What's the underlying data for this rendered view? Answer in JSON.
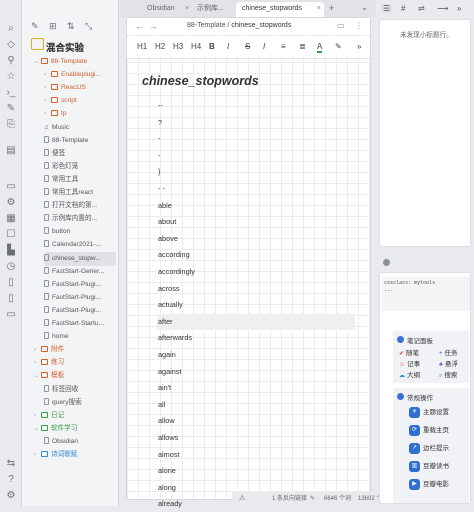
{
  "ribbon": {
    "icons": [
      "file-explorer-icon",
      "search-icon",
      "tag-icon",
      "graph-icon",
      "star-icon",
      "settings-icon",
      "tag-pane-icon",
      "terminal-icon",
      "calendar-icon",
      "template-icon",
      "outline-icon",
      "page-icon",
      "help-icon",
      "vault-settings-icon"
    ]
  },
  "explorer": {
    "vault_name": "混合实验",
    "tree": [
      {
        "label": "88-Template",
        "type": "folder",
        "level": 0,
        "open": true,
        "color": "#d4602b"
      },
      {
        "label": "Enableplugi...",
        "type": "folder",
        "level": 1,
        "open": false,
        "color": "#d4602b"
      },
      {
        "label": "ReactJS",
        "type": "folder",
        "level": 1,
        "open": false,
        "color": "#d4602b"
      },
      {
        "label": "script",
        "type": "folder",
        "level": 1,
        "open": false,
        "color": "#d4602b"
      },
      {
        "label": "tp",
        "type": "folder",
        "level": 1,
        "open": false,
        "color": "#d4602b"
      },
      {
        "label": "Music",
        "type": "file-music",
        "level": 1
      },
      {
        "label": "88-Template",
        "type": "file",
        "level": 1
      },
      {
        "label": "便签",
        "type": "file",
        "level": 1
      },
      {
        "label": "彩色灯笼",
        "type": "file",
        "level": 1
      },
      {
        "label": "常用工具",
        "type": "file",
        "level": 1
      },
      {
        "label": "常用工具react",
        "type": "file",
        "level": 1
      },
      {
        "label": "打开文档的第...",
        "type": "file",
        "level": 1
      },
      {
        "label": "示例库内置的...",
        "type": "file",
        "level": 1
      },
      {
        "label": "button",
        "type": "file",
        "level": 1
      },
      {
        "label": "Calendar2021-...",
        "type": "file",
        "level": 1
      },
      {
        "label": "chinese_stopw...",
        "type": "file",
        "level": 1,
        "selected": true
      },
      {
        "label": "FastStart-Gener...",
        "type": "file",
        "level": 1
      },
      {
        "label": "FastStart-Plugi...",
        "type": "file",
        "level": 1
      },
      {
        "label": "FastStart-Plugi...",
        "type": "file",
        "level": 1
      },
      {
        "label": "FastStart-Plugi...",
        "type": "file",
        "level": 1
      },
      {
        "label": "FastStart-Startu...",
        "type": "file",
        "level": 1
      },
      {
        "label": "home",
        "type": "file",
        "level": 1
      },
      {
        "label": "附件",
        "type": "folder",
        "level": 0,
        "open": false,
        "color": "#d4602b"
      },
      {
        "label": "练习",
        "type": "folder",
        "level": 0,
        "open": false,
        "color": "#d4602b"
      },
      {
        "label": "模板",
        "type": "folder",
        "level": 0,
        "open": true,
        "color": "#d4602b"
      },
      {
        "label": "标签回收",
        "type": "file",
        "level": 1
      },
      {
        "label": "query搜索",
        "type": "file",
        "level": 1
      },
      {
        "label": "日记",
        "type": "folder",
        "level": 0,
        "open": false,
        "color": "#3d9a4b"
      },
      {
        "label": "软件学习",
        "type": "folder",
        "level": 0,
        "open": true,
        "color": "#3d9a4b"
      },
      {
        "label": "Obsidian",
        "type": "file",
        "level": 1
      },
      {
        "label": "诗词歌赋",
        "type": "folder",
        "level": 0,
        "open": false,
        "color": "#2f8ad2"
      }
    ]
  },
  "tabs": [
    {
      "label": "Obsidian",
      "active": false
    },
    {
      "label": "示例库...",
      "active": false
    },
    {
      "label": "chinese_stopwords",
      "active": true
    }
  ],
  "editor": {
    "breadcrumb_folder": "88-Template",
    "breadcrumb_sep": "/",
    "breadcrumb_file": "chinese_stopwords",
    "toolbar": [
      "H1",
      "H2",
      "H3",
      "H4",
      "B",
      "I",
      "S",
      "I",
      "≡",
      "≣",
      "A",
      "✎"
    ],
    "title": "chinese_stopwords",
    "words": [
      "--",
      "?",
      "-",
      "-",
      "}",
      "- -",
      "able",
      "about",
      "above",
      "according",
      "accordingly",
      "across",
      "actually",
      "after",
      "afterwards",
      "again",
      "against",
      "ain't",
      "all",
      "allow",
      "allows",
      "almost",
      "alone",
      "along",
      "already"
    ],
    "highlighted_word": "after"
  },
  "status": {
    "backlinks": "1 条反向链接",
    "words": "6646 个词",
    "chars": "13602 个字符"
  },
  "right_sidebar": {
    "outline_empty": "未发现小标题行。",
    "code_lines": [
      "cssclass: mytools",
      "---"
    ],
    "panel1_title": "笔记面板",
    "panel1_items": [
      {
        "icon": "✔",
        "label": "随笔"
      },
      {
        "icon": "+",
        "label": "任务"
      },
      {
        "icon": "☺",
        "label": "记事"
      },
      {
        "icon": "♣",
        "label": "悬浮"
      },
      {
        "icon": "☁",
        "label": "大纲"
      },
      {
        "icon": "⌕",
        "label": "搜索"
      }
    ],
    "panel2_title": "常规操作",
    "actions": [
      "主题设置",
      "重载主页",
      "边栏提示",
      "豆瓣读书",
      "豆瓣电影"
    ]
  }
}
